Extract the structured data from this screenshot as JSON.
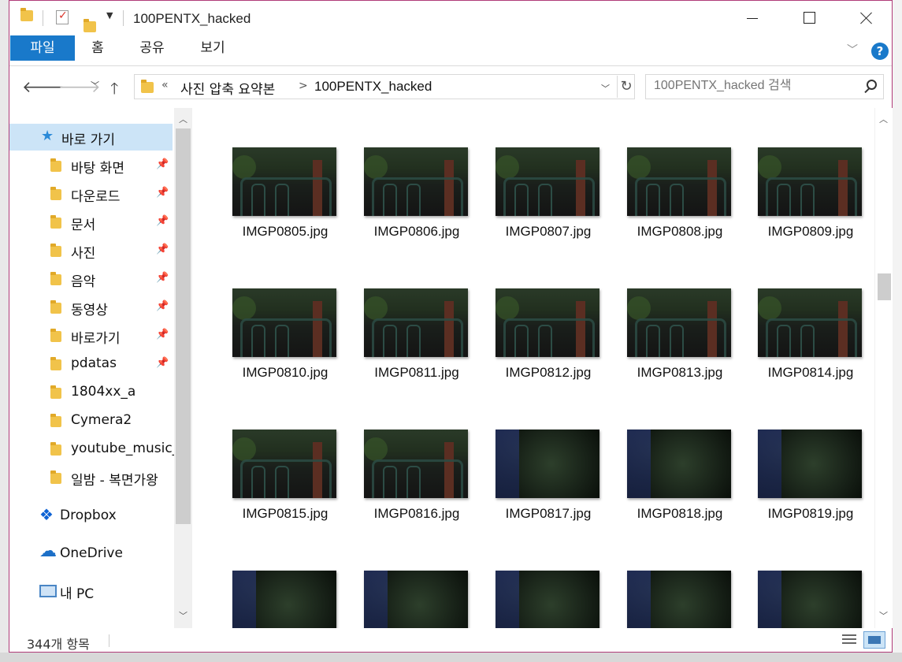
{
  "window": {
    "title": "100PENTX_hacked"
  },
  "ribbon": {
    "tabs": [
      {
        "label": "파일"
      },
      {
        "label": "홈"
      },
      {
        "label": "공유"
      },
      {
        "label": "보기"
      }
    ],
    "help": "?"
  },
  "address": {
    "chevrons": "«",
    "crumbs": [
      "사진 압축 요약본",
      "100PENTX_hacked"
    ],
    "separator": ">"
  },
  "search": {
    "placeholder": "100PENTX_hacked 검색"
  },
  "nav": {
    "items": [
      {
        "label": "바로 가기",
        "icon": "star-icon",
        "pinned": false
      },
      {
        "label": "바탕 화면",
        "icon": "desktop-folder-icon",
        "pinned": true
      },
      {
        "label": "다운로드",
        "icon": "downloads-folder-icon",
        "pinned": true
      },
      {
        "label": "문서",
        "icon": "documents-folder-icon",
        "pinned": true
      },
      {
        "label": "사진",
        "icon": "pictures-folder-icon",
        "pinned": true
      },
      {
        "label": "음악",
        "icon": "music-folder-icon",
        "pinned": true
      },
      {
        "label": "동영상",
        "icon": "videos-folder-icon",
        "pinned": true
      },
      {
        "label": "바로가기",
        "icon": "folder-icon",
        "pinned": true
      },
      {
        "label": "pdatas",
        "icon": "folder-icon",
        "pinned": true
      },
      {
        "label": "1804xx_a",
        "icon": "synced-folder-icon",
        "pinned": false
      },
      {
        "label": "Cymera2",
        "icon": "folder-icon",
        "pinned": false
      },
      {
        "label": "youtube_music_",
        "icon": "folder-icon",
        "pinned": false
      },
      {
        "label": "일밤 - 복면가왕",
        "icon": "folder-icon",
        "pinned": false
      },
      {
        "label": "Dropbox",
        "icon": "dropbox-icon",
        "pinned": false
      },
      {
        "label": "OneDrive",
        "icon": "onedrive-icon",
        "pinned": false
      },
      {
        "label": "내 PC",
        "icon": "pc-icon",
        "pinned": false
      }
    ],
    "pin_glyph": "📌"
  },
  "files": [
    {
      "name": "IMGP0805.jpg",
      "scene": "a"
    },
    {
      "name": "IMGP0806.jpg",
      "scene": "a"
    },
    {
      "name": "IMGP0807.jpg",
      "scene": "a"
    },
    {
      "name": "IMGP0808.jpg",
      "scene": "a"
    },
    {
      "name": "IMGP0809.jpg",
      "scene": "a"
    },
    {
      "name": "IMGP0810.jpg",
      "scene": "a"
    },
    {
      "name": "IMGP0811.jpg",
      "scene": "a"
    },
    {
      "name": "IMGP0812.jpg",
      "scene": "a"
    },
    {
      "name": "IMGP0813.jpg",
      "scene": "a"
    },
    {
      "name": "IMGP0814.jpg",
      "scene": "a"
    },
    {
      "name": "IMGP0815.jpg",
      "scene": "a"
    },
    {
      "name": "IMGP0816.jpg",
      "scene": "a"
    },
    {
      "name": "IMGP0817.jpg",
      "scene": "b"
    },
    {
      "name": "IMGP0818.jpg",
      "scene": "b"
    },
    {
      "name": "IMGP0819.jpg",
      "scene": "b"
    },
    {
      "name": "",
      "scene": "b"
    },
    {
      "name": "",
      "scene": "b"
    },
    {
      "name": "",
      "scene": "b"
    },
    {
      "name": "",
      "scene": "b"
    },
    {
      "name": "",
      "scene": "b"
    }
  ],
  "status": {
    "count": "344개 항목"
  },
  "colors": {
    "accent": "#1979ca",
    "selection": "#cce4f7",
    "window_border": "#b03b79"
  }
}
